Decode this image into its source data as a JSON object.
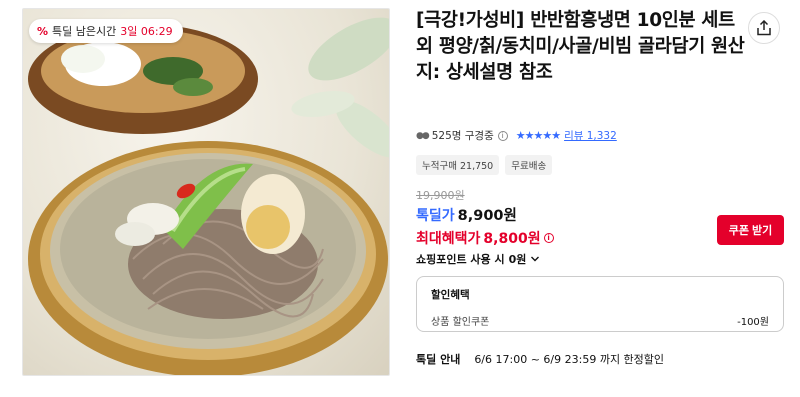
{
  "image": {
    "timer_badge": {
      "icon": "percent-icon",
      "label": "특딜 남은시간",
      "value": "3일 06:29"
    }
  },
  "product": {
    "title": "[극강!가성비] 반반함흥냉면 10인분 세트 외 평양/칡/동치미/사골/비빔 골라담기 원산지: 상세설명 참조",
    "share_icon": "share-icon"
  },
  "rating": {
    "viewer_count": "525명 구경중",
    "stars": 5,
    "review_label": "리뷰 1,332"
  },
  "tags": [
    "누적구매 21,750",
    "무료배송"
  ],
  "price": {
    "original": "19,900원",
    "deal_label": "톡딜가",
    "deal_price": "8,900원",
    "benefit_label": "최대혜택가",
    "benefit_price": "8,800원",
    "coupon_button": "쿠폰 받기"
  },
  "points": {
    "label": "쇼핑포인트 사용 시",
    "value": "0원"
  },
  "discount": {
    "title": "할인혜택",
    "item_label": "상품 할인쿠폰",
    "item_amount": "-100원"
  },
  "deal_info": {
    "label": "톡딜 안내",
    "text": "6/6 17:00 ~ 6/9 23:59 까지 한정할인"
  },
  "colors": {
    "accent_red": "#e4002b",
    "accent_blue": "#346aff"
  }
}
